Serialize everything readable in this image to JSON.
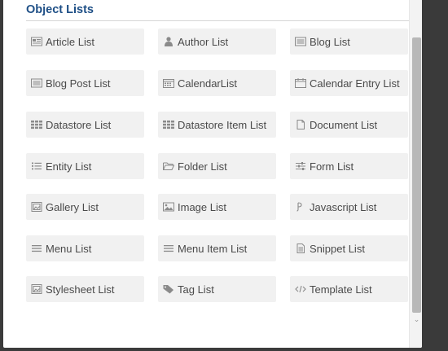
{
  "section": {
    "title": "Object Lists"
  },
  "tiles": [
    {
      "label": "Article List",
      "icon": "article-icon"
    },
    {
      "label": "Author List",
      "icon": "author-icon"
    },
    {
      "label": "Blog List",
      "icon": "blog-icon"
    },
    {
      "label": "Blog Post List",
      "icon": "blog-post-icon"
    },
    {
      "label": "CalendarList",
      "icon": "calendar-icon"
    },
    {
      "label": "Calendar Entry List",
      "icon": "calendar-entry-icon"
    },
    {
      "label": "Datastore List",
      "icon": "datastore-icon"
    },
    {
      "label": "Datastore Item List",
      "icon": "datastore-item-icon"
    },
    {
      "label": "Document List",
      "icon": "document-icon"
    },
    {
      "label": "Entity List",
      "icon": "entity-icon"
    },
    {
      "label": "Folder List",
      "icon": "folder-icon"
    },
    {
      "label": "Form List",
      "icon": "form-icon"
    },
    {
      "label": "Gallery List",
      "icon": "gallery-icon"
    },
    {
      "label": "Image List",
      "icon": "image-icon"
    },
    {
      "label": "Javascript List",
      "icon": "javascript-icon"
    },
    {
      "label": "Menu List",
      "icon": "menu-icon"
    },
    {
      "label": "Menu Item List",
      "icon": "menu-item-icon"
    },
    {
      "label": "Snippet List",
      "icon": "snippet-icon"
    },
    {
      "label": "Stylesheet List",
      "icon": "stylesheet-icon"
    },
    {
      "label": "Tag List",
      "icon": "tag-icon"
    },
    {
      "label": "Template List",
      "icon": "template-icon"
    }
  ],
  "colors": {
    "title": "#1e4f86",
    "tile_bg": "#f1f1f1",
    "text": "#4a4a4a"
  }
}
